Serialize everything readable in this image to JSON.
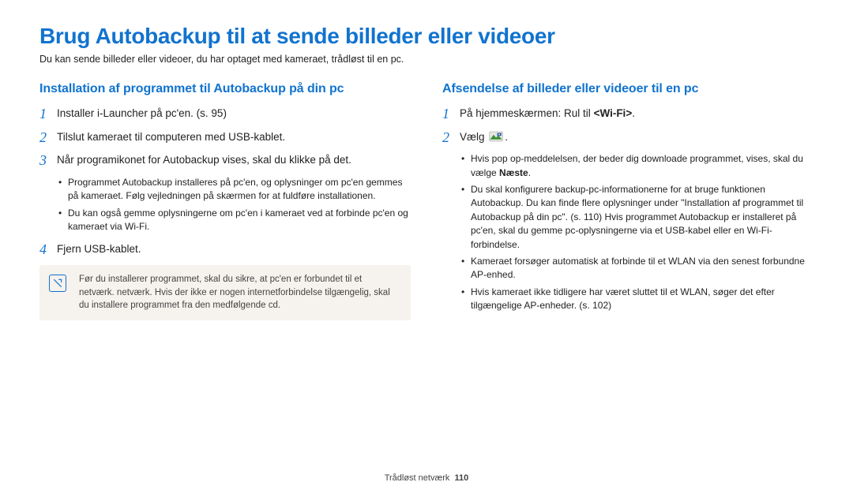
{
  "title": "Brug Autobackup til at sende billeder eller videoer",
  "intro": "Du kan sende billeder eller videoer, du har optaget med kameraet, trådløst til en pc.",
  "left": {
    "heading": "Installation af programmet til Autobackup på din pc",
    "step1": "Installer i-Launcher på pc'en. (s. 95)",
    "step2": "Tilslut kameraet til computeren med USB-kablet.",
    "step3": "Når programikonet for Autobackup vises, skal du klikke på det.",
    "step3_sub1": "Programmet Autobackup installeres på pc'en, og oplysninger om pc'en gemmes på kameraet. Følg vejledningen på skærmen for at fuldføre installationen.",
    "step3_sub2": "Du kan også gemme oplysningerne om pc'en i kameraet ved at forbinde pc'en og kameraet via Wi-Fi.",
    "step4": "Fjern USB-kablet.",
    "note": "Før du installerer programmet, skal du sikre, at pc'en er forbundet til et netværk. netværk. Hvis der ikke er nogen internetforbindelse tilgængelig, skal du installere programmet fra den medfølgende cd."
  },
  "right": {
    "heading": "Afsendelse af billeder eller videoer til en pc",
    "step1_pre": "På hjemmeskærmen: Rul til ",
    "step1_bold": "<Wi-Fi>",
    "step1_post": ".",
    "step2_pre": "Vælg ",
    "step2_post": ".",
    "sub1_pre": "Hvis pop op-meddelelsen, der beder dig downloade programmet, vises, skal du vælge ",
    "sub1_bold": "Næste",
    "sub1_post": ".",
    "sub2": "Du skal konfigurere backup-pc-informationerne for at bruge funktionen Autobackup. Du kan finde flere oplysninger under \"Installation af programmet til Autobackup på din pc\". (s. 110) Hvis programmet Autobackup er installeret på pc'en, skal du gemme pc-oplysningerne via et USB-kabel eller en Wi-Fi-forbindelse.",
    "sub3": "Kameraet forsøger automatisk at forbinde til et WLAN via den senest forbundne AP-enhed.",
    "sub4": "Hvis kameraet ikke tidligere har været sluttet til et WLAN, søger det efter tilgængelige AP-enheder. (s. 102)"
  },
  "numbers": {
    "n1": "1",
    "n2": "2",
    "n3": "3",
    "n4": "4"
  },
  "footer": {
    "section": "Trådløst netværk",
    "page": "110"
  }
}
